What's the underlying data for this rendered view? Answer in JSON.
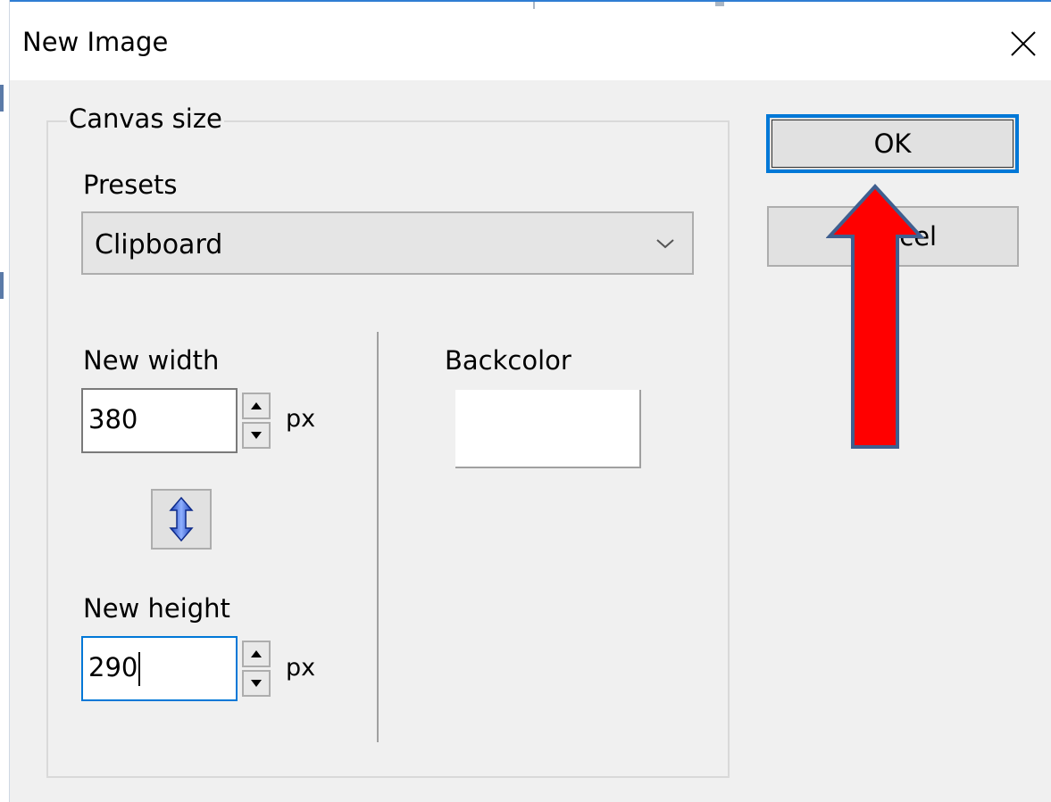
{
  "dialog": {
    "title": "New Image",
    "close_icon": "close-icon"
  },
  "canvas_group": {
    "legend": "Canvas size",
    "presets_label": "Presets",
    "presets_selected": "Clipboard",
    "width_label": "New width",
    "width_value": "380",
    "width_unit": "px",
    "height_label": "New height",
    "height_value": "290",
    "height_unit": "px",
    "link_icon": "vertical-double-arrow-icon",
    "backcolor_label": "Backcolor",
    "backcolor_value": "#ffffff"
  },
  "buttons": {
    "ok_label": "OK",
    "cancel_label": "Cancel"
  },
  "annotation": {
    "arrow_color": "#ff0000",
    "arrow_outline": "#3f5f8f",
    "arrow_icon": "red-up-arrow-annotation"
  },
  "colors": {
    "focus_blue": "#0078d7",
    "dialog_bg": "#f0f0f0"
  }
}
